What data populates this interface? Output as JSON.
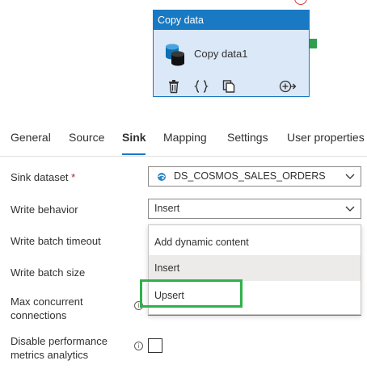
{
  "activity": {
    "header": "Copy data",
    "name": "Copy data1"
  },
  "tabs": [
    "General",
    "Source",
    "Sink",
    "Mapping",
    "Settings",
    "User properties"
  ],
  "active_tab": "Sink",
  "form": {
    "sink_dataset_label": "Sink dataset",
    "required_mark": "*",
    "sink_dataset_value": "DS_COSMOS_SALES_ORDERS",
    "write_behavior_label": "Write behavior",
    "write_behavior_value": "Insert",
    "write_batch_timeout_label": "Write batch timeout",
    "write_batch_size_label": "Write batch size",
    "max_concurrent_label_1": "Max concurrent",
    "max_concurrent_label_2": "connections",
    "disable_perf_label_1": "Disable performance",
    "disable_perf_label_2": "metrics analytics"
  },
  "dropdown": {
    "options": [
      "Add dynamic content",
      "Insert",
      "Upsert"
    ],
    "hovered": "Insert",
    "highlighted": "Upsert"
  },
  "colors": {
    "accent": "#1979c3",
    "highlight": "#2fb14a",
    "success_connector": "#2e9e4f",
    "error_connector": "#d13438"
  },
  "icons": {
    "dataset": "cosmos-db-icon",
    "delete": "trash-icon",
    "code": "braces-icon",
    "copy": "clone-icon",
    "add_output": "add-output-icon"
  }
}
